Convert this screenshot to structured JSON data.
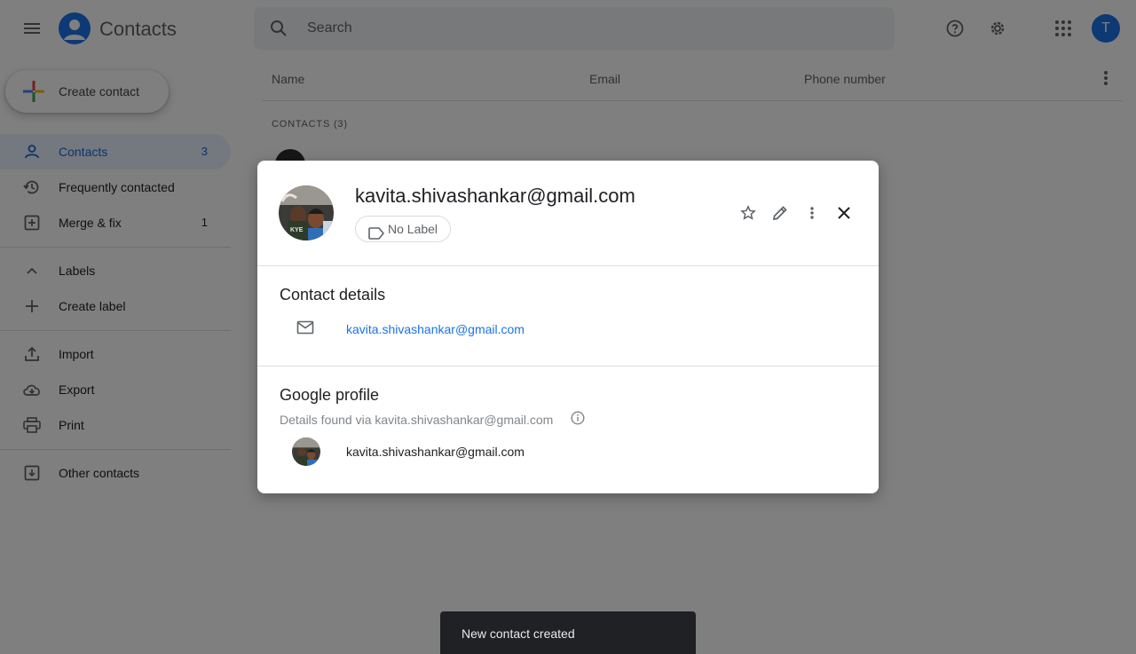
{
  "app": {
    "title": "Contacts",
    "user_initial": "T"
  },
  "search": {
    "placeholder": "Search"
  },
  "sidebar": {
    "create_label": "Create contact",
    "items": [
      {
        "label": "Contacts",
        "count": "3",
        "icon": "person-icon"
      },
      {
        "label": "Frequently contacted",
        "count": "",
        "icon": "history-icon"
      },
      {
        "label": "Merge & fix",
        "count": "1",
        "icon": "merge-icon"
      }
    ],
    "labels_header": "Labels",
    "create_label_item": "Create label",
    "tools": [
      {
        "label": "Import",
        "icon": "upload-icon"
      },
      {
        "label": "Export",
        "icon": "cloud-download-icon"
      },
      {
        "label": "Print",
        "icon": "printer-icon"
      }
    ],
    "other_contacts": "Other contacts"
  },
  "list": {
    "columns": [
      "Name",
      "Email",
      "Phone number"
    ],
    "section_header": "CONTACTS (3)"
  },
  "dialog": {
    "name": "kavita.shivashankar@gmail.com",
    "label_chip": "No Label",
    "contact_details_title": "Contact details",
    "email": "kavita.shivashankar@gmail.com",
    "google_profile_title": "Google profile",
    "details_found": "Details found via kavita.shivashankar@gmail.com",
    "profile_email": "kavita.shivashankar@gmail.com"
  },
  "toast": {
    "message": "New contact created"
  },
  "colors": {
    "accent": "#1a73e8",
    "active_bg": "#e8f0fe",
    "scrim": "rgba(0,0,0,0.5)"
  }
}
